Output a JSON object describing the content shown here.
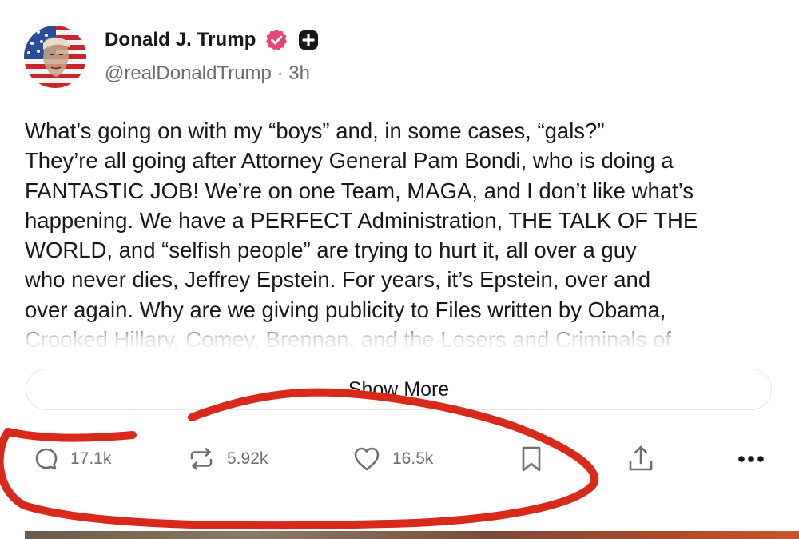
{
  "author": {
    "display_name": "Donald J. Trump",
    "handle": "@realDonaldTrump",
    "separator": "·",
    "time": "3h",
    "avatar_icon": "flag-portrait-avatar",
    "verified_icon": "verified-badge-icon",
    "badge_icon": "plus-badge-icon"
  },
  "post": {
    "text": "What’s going on with my “boys” and, in some cases, “gals?”\nThey’re all going after Attorney General Pam Bondi, who is doing a\nFANTASTIC JOB! We’re on one Team, MAGA, and I don’t like what’s\nhappening. We have a PERFECT Administration, THE TALK OF THE\nWORLD, and “selfish people” are trying to hurt it, all over a guy\nwho never dies, Jeffrey Epstein. For years, it’s Epstein, over and\nover again. Why are we giving publicity to Files written by Obama,\nCrooked Hillary, Comey, Brennan, and the Losers and Criminals of",
    "show_more_label": "Show More"
  },
  "actions": {
    "replies": "17.1k",
    "reposts": "5.92k",
    "likes": "16.5k",
    "icons": [
      "reply-icon",
      "repost-icon",
      "like-icon",
      "bookmark-icon",
      "share-icon",
      "more-icon"
    ]
  },
  "colors": {
    "text": "#18181b",
    "secondary_text": "#6b6b78",
    "verified_badge": "#e8447a",
    "annotation_stroke": "#d9281c"
  }
}
